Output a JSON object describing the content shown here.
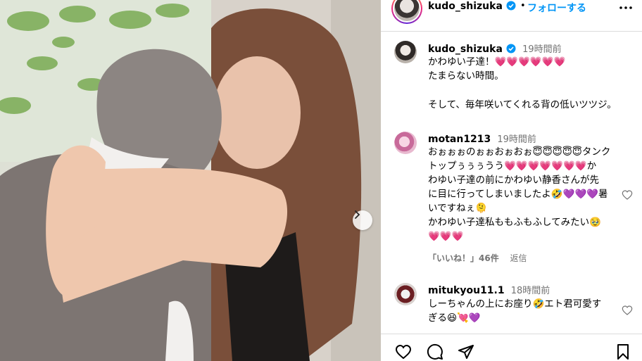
{
  "photo": {
    "next_icon": "chevron-right-icon"
  },
  "header": {
    "username": "kudo_shizuka",
    "separator": "•",
    "follow_label": "フォローする",
    "more_icon": "more-horizontal-icon"
  },
  "caption": {
    "username": "kudo_shizuka",
    "time": "19時間前",
    "lines": [
      "かわゆい子達！💗💗💗💗💗💗",
      "たまらない時間。",
      "そして、毎年咲いてくれる背の低いツツジ。"
    ]
  },
  "comments": [
    {
      "username": "motan1213",
      "time": "19時間前",
      "lines": [
        "おぉぉぉのぉぉおぉおぉ😇😇😇😇😇タンク",
        "トップぅぅぅうう💗💗💗💗💗💗💗か",
        "わゆい子達の前にかわゆい静香さんが先",
        "に目に行ってしまいましたよ🤣💜💜💜暑",
        "いですねぇ🫠",
        "かわゆい子達私ももふもふしてみたい🥹",
        "💗💗💗"
      ],
      "likes": "「いいね！」46件",
      "reply": "返信"
    },
    {
      "username": "mitukyou11.1",
      "time": "18時間前",
      "lines": [
        "しーちゃんの上にお座り🤣エト君可愛す",
        "ぎる😆💘💜"
      ]
    }
  ],
  "actions": {
    "like_icon": "heart-icon",
    "comment_icon": "comment-icon",
    "share_icon": "share-icon",
    "save_icon": "bookmark-icon"
  },
  "colors": {
    "accent": "#0095f6",
    "muted": "#737373",
    "divider": "#dbdbdb"
  }
}
